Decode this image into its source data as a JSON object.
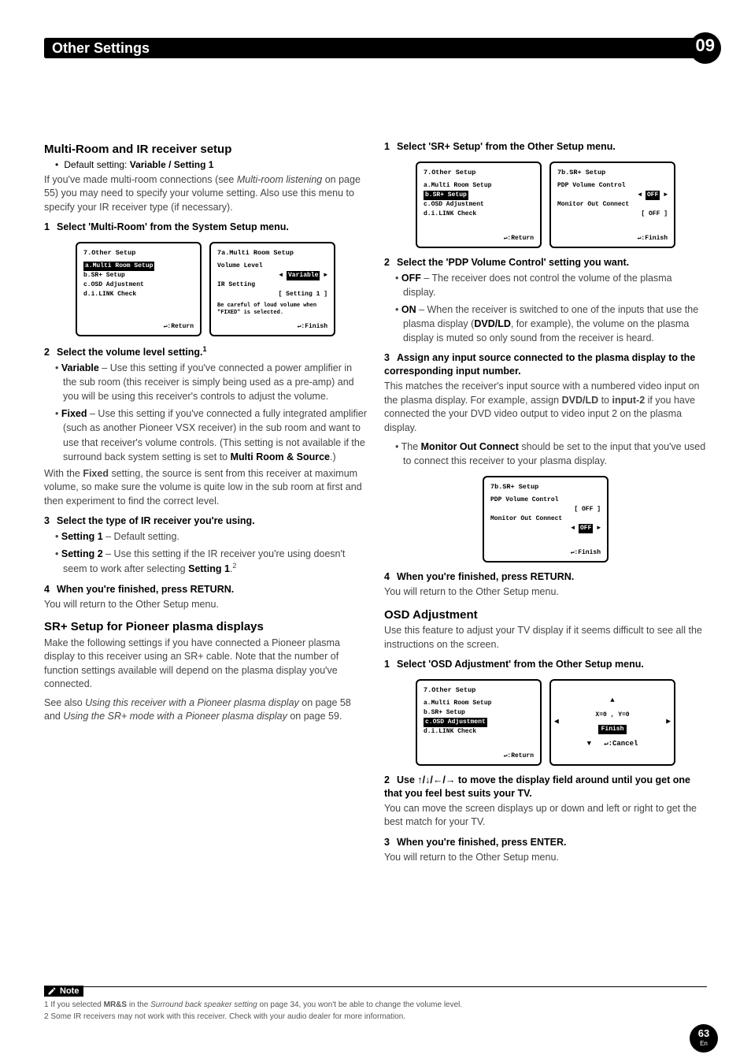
{
  "header": {
    "chapter_title": "Other Settings",
    "chapter_num": "09"
  },
  "left": {
    "sec1_title": "Multi-Room and IR receiver setup",
    "default_line": "Default setting: ",
    "default_vals": "Variable / Setting 1",
    "intro": "If you've made multi-room connections (see ",
    "intro_em": "Multi-room listening",
    "intro2": " on page 55) you may need to specify your volume setting. Also use this menu to specify your IR receiver type (if necessary).",
    "step1": "Select 'Multi-Room' from the System Setup menu.",
    "osd7_title": "7.Other Setup",
    "osd7_a": "a.Multi Room Setup",
    "osd7_b": "b.SR+ Setup",
    "osd7_c": "c.OSD Adjustment",
    "osd7_d": "d.i.LINK Check",
    "osd7_ret": ":Return",
    "osd7a_title": "7a.Multi Room Setup",
    "osd7a_vl": "Volume Level",
    "osd7a_var": "Variable",
    "osd7a_ir": "IR Setting",
    "osd7a_s1": "[ Setting 1 ]",
    "osd7a_note": "Be careful of loud volume when \"FIXED\" is selected.",
    "osd7a_fin": ":Finish",
    "step2": "Select the volume level setting.",
    "step2_sup": "1",
    "b_var_t": "Variable",
    "b_var": " – Use this setting if you've connected a power amplifier in the sub room (this receiver is simply being used as a pre-amp) and you will be using this receiver's controls to adjust the volume.",
    "b_fix_t": "Fixed",
    "b_fix": " – Use this setting if you've connected a fully integrated amplifier (such as another Pioneer VSX receiver) in the sub room and want to use that receiver's volume controls. (This setting is not available if the surround back system setting is set to ",
    "b_fix2": "Multi Room & Source",
    "b_fix3": ".)",
    "fixed_para": "With the Fixed setting, the source is sent from this receiver at maximum volume, so make sure the volume is quite low in the sub room at first and then experiment to find the correct level.",
    "step3": "Select the type of IR receiver you're using.",
    "b_s1_t": "Setting 1",
    "b_s1": " – Default setting.",
    "b_s2_t": "Setting 2",
    "b_s2": " – Use this setting if the IR receiver you're using doesn't seem to work after selecting ",
    "b_s2b": "Setting 1",
    "b_s2c": ".",
    "step3_sup": "2",
    "step4": "When you're finished, press RETURN.",
    "step4_sub": "You will return to the Other Setup menu.",
    "sec2_title": "SR+ Setup for Pioneer plasma displays",
    "sr_para1": "Make the following settings if you have connected a Pioneer plasma display to this receiver using an SR+ cable. Note that the number of function settings available will depend on the plasma display you've connected.",
    "sr_para2a": "See also ",
    "sr_para2b": "Using this receiver with a Pioneer plasma display",
    "sr_para2c": " on page 58 and ",
    "sr_para2d": "Using the SR+ mode with a Pioneer plasma display",
    "sr_para2e": " on page 59."
  },
  "right": {
    "step1": "Select 'SR+ Setup' from the Other Setup menu.",
    "osd7_title": "7.Other Setup",
    "osd7_a": "a.Multi Room Setup",
    "osd7_b": "b.SR+ Setup",
    "osd7_c": "c.OSD Adjustment",
    "osd7_d": "d.i.LINK Check",
    "osd7_ret": ":Return",
    "osd7b_title": "7b.SR+ Setup",
    "osd7b_pdp": "PDP Volume Control",
    "osd7b_off": "OFF",
    "osd7b_mon": "Monitor Out Connect",
    "osd7b_off2": "[ OFF ]",
    "osd7b_fin": ":Finish",
    "step2": "Select the 'PDP Volume Control' setting you want.",
    "b_off_t": "OFF",
    "b_off": " – The receiver does not control the volume of the plasma display.",
    "b_on_t": "ON",
    "b_on": " – When the receiver is switched to one of the inputs that use the plasma display (",
    "b_on_b": "DVD/LD",
    "b_on2": ", for example), the volume on the plasma display is muted so only sound from the receiver is heard.",
    "step3": "Assign any input source connected to the plasma display to the corresponding input number.",
    "step3_para_a": "This matches the receiver's input source with a numbered video input on the plasma display. For example, assign ",
    "step3_para_b": "DVD/LD",
    "step3_para_c": " to ",
    "step3_para_d": "input-2",
    "step3_para_e": " if you have connected the your DVD video output to video input 2 on the plasma display.",
    "b_mon_a": "The ",
    "b_mon_t": "Monitor Out Connect",
    "b_mon": " should be set to the input that you've used to connect this receiver to your plasma display.",
    "osd7b2_title": "7b.SR+ Setup",
    "osd7b2_pdp": "PDP Volume Control",
    "osd7b2_off": "[ OFF ]",
    "osd7b2_mon": "Monitor Out Connect",
    "osd7b2_hl": "OFF",
    "osd7b2_fin": ":Finish",
    "step4": "When you're finished, press RETURN.",
    "step4_sub": "You will return to the Other Setup menu.",
    "sec3_title": "OSD Adjustment",
    "osd_para": "Use this feature to adjust your TV display if it seems difficult to see all the instructions on the screen.",
    "ostep1": "Select 'OSD Adjustment' from the Other Setup menu.",
    "osdA_title": "7.Other Setup",
    "osdA_a": "a.Multi Room Setup",
    "osdA_b": "b.SR+ Setup",
    "osdA_c": "c.OSD Adjustment",
    "osdA_d": "d.i.LINK Check",
    "osdA_ret": ":Return",
    "osdA_xy": "X=0 , Y=0",
    "osdA_fin": "Finish",
    "osdA_cancel": ":Cancel",
    "ostep2": "Use / / /  to move the display field around until you get one that you feel best suits your TV.",
    "ostep2_sub": "You can move the screen displays up or down and left or right to get the best match for your TV.",
    "ostep3": "When you're finished, press ENTER.",
    "ostep3_sub": "You will return to the Other Setup menu."
  },
  "notes": {
    "label": "Note",
    "n1a": "1 If you selected ",
    "n1b": "MR&S",
    "n1c": " in the ",
    "n1d": "Surround back speaker setting",
    "n1e": " on page 34, you won't be able to change the volume level.",
    "n2": "2 Some IR receivers may not work with this receiver. Check with your audio dealer for more information."
  },
  "page": {
    "num": "63",
    "lang": "En"
  }
}
